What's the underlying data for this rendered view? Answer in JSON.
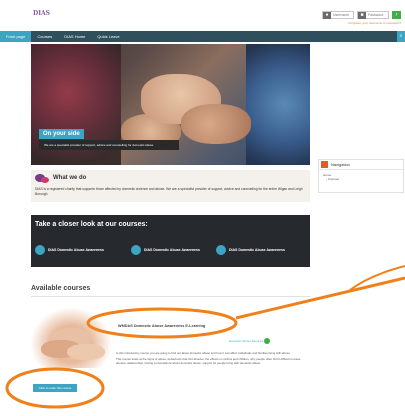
{
  "header": {
    "logo_main": "DIAS",
    "logo_sub": "",
    "username_placeholder": "Username",
    "password_placeholder": "Password",
    "go_label": "›",
    "forgot": "Forgotten your username or password?"
  },
  "nav": {
    "items": [
      "Front page",
      "Courses",
      "DIAS Home",
      "Quick Leave"
    ],
    "search_icon": "search-icon"
  },
  "hero": {
    "title": "On your side",
    "subtitle": "We are a specialist provider of support, advice and counselling for domestic abuse"
  },
  "what_we_do": {
    "title": "What we do",
    "text": "DIAS is a registered charity that supports those affected by domestic violence and abuse. We are a specialist provider of support, advice and counselling for the entire Wigan and Leigh Borough."
  },
  "closer_look": {
    "title": "Take a closer look at our courses:",
    "courses": [
      "DIAS Domestic Abuse Awareness",
      "DIAS Domestic Abuse Awareness",
      "DIAS Domestic Abuse Awareness"
    ]
  },
  "sidebar": {
    "title": "Navigation",
    "home": "Home",
    "courses": "Courses"
  },
  "available": {
    "title": "Available courses",
    "course_name": "WMDAS Domestic Abuse Awareness E-Learning",
    "logo_text": "Domestic Abuse Services",
    "description_1": "In this introductory course you are going to find out about domestic abuse and how it can affect individuals and families living with abuse.",
    "description_2": "This course looks at the signs of abuse, behaviours that hint abusive, the effects on victims and children, why people often find it difficult to leave abusive relationships, having conversations about domestic abuse, support for people living with domestic abuse.",
    "enter_button": "Click to enter this course"
  },
  "colors": {
    "accent": "#3da4c4",
    "nav_bg": "#2e4f5b",
    "annotation": "#f0801a"
  }
}
